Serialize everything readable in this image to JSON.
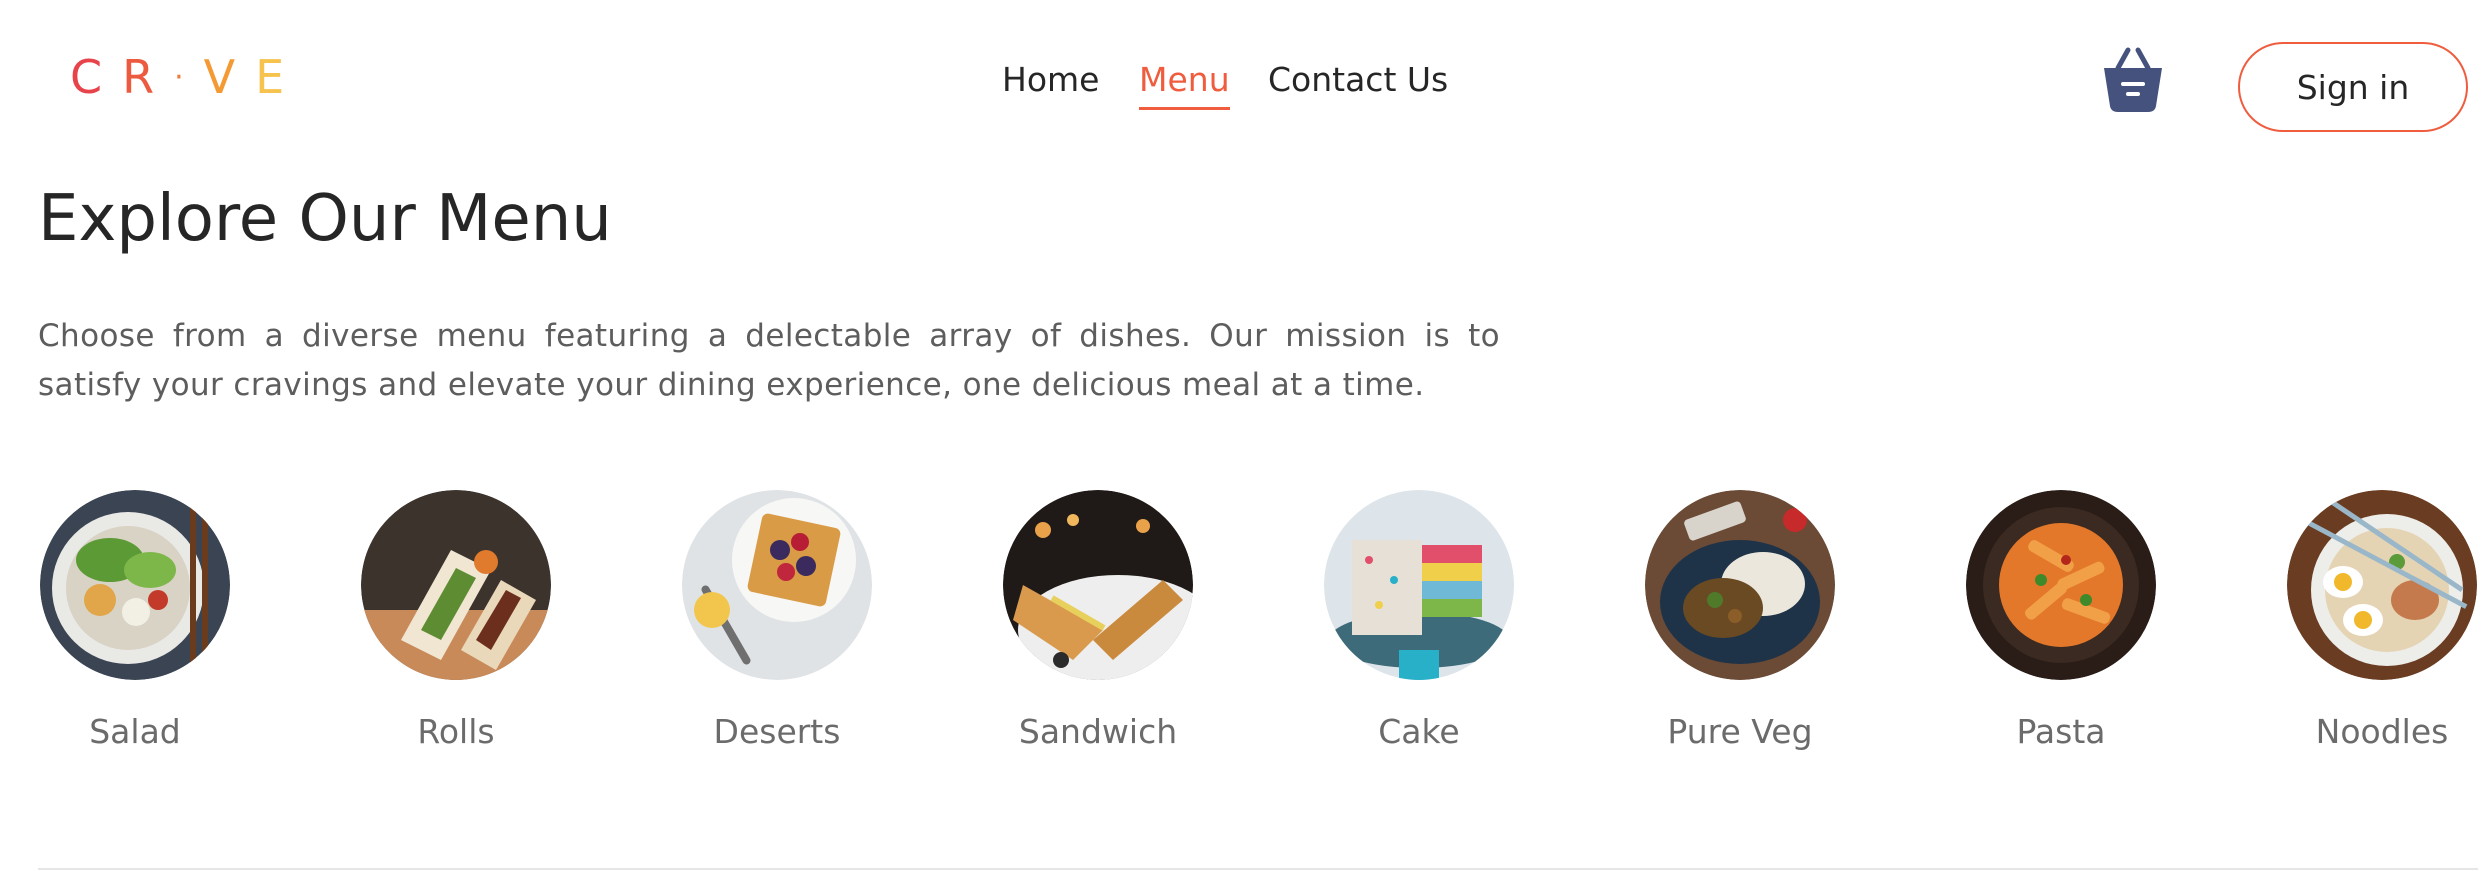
{
  "logo": {
    "letters": [
      "C",
      "R",
      "·",
      "V",
      "E"
    ],
    "colors": [
      "#e8424a",
      "#ec5a3f",
      "#f07c3a",
      "#f39a34",
      "#f5c34e"
    ]
  },
  "nav": {
    "items": [
      {
        "label": "Home"
      },
      {
        "label": "Menu"
      },
      {
        "label": "Contact Us"
      }
    ],
    "active": "Menu"
  },
  "header": {
    "basket_icon": "basket-icon",
    "signin_label": "Sign in"
  },
  "main": {
    "title": "Explore Our Menu",
    "description": "Choose from a diverse menu featuring a delectable array of dishes. Our mission is to satisfy your cravings and elevate your dining experience, one delicious meal at a time."
  },
  "categories": [
    {
      "label": "Salad"
    },
    {
      "label": "Rolls"
    },
    {
      "label": "Deserts"
    },
    {
      "label": "Sandwich"
    },
    {
      "label": "Cake"
    },
    {
      "label": "Pure Veg"
    },
    {
      "label": "Pasta"
    },
    {
      "label": "Noodles"
    }
  ],
  "colors": {
    "accent": "#ef5d3e",
    "basket": "#46527e",
    "text": "#262626",
    "muted": "#5d5d5d"
  }
}
